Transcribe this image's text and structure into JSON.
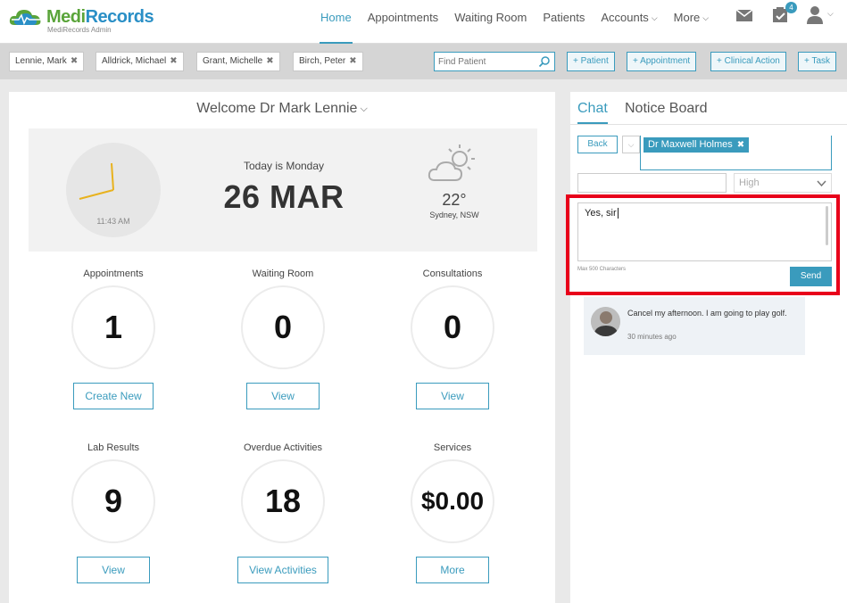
{
  "brand": {
    "name_part1": "Medi",
    "name_part2": "Records",
    "subtitle": "MediRecords Admin",
    "accent": "#3a9bbd"
  },
  "nav": {
    "items": [
      {
        "label": "Home",
        "active": true
      },
      {
        "label": "Appointments"
      },
      {
        "label": "Waiting Room"
      },
      {
        "label": "Patients"
      },
      {
        "label": "Accounts",
        "dropdown": true
      },
      {
        "label": "More",
        "dropdown": true
      }
    ],
    "tasks_badge": "4",
    "icons": [
      "mail-icon",
      "tasks-icon",
      "user-icon"
    ]
  },
  "patient_tabs": [
    {
      "label": "Lennie, Mark"
    },
    {
      "label": "Alldrick, Michael"
    },
    {
      "label": "Grant, Michelle"
    },
    {
      "label": "Birch, Peter"
    }
  ],
  "find_patient": {
    "placeholder": "Find Patient"
  },
  "quick_actions": [
    "+ Patient",
    "+ Appointment",
    "+ Clinical Action",
    "+ Task"
  ],
  "dashboard": {
    "welcome": "Welcome Dr Mark Lennie",
    "clock_time": "11:43 AM",
    "today_label": "Today is Monday",
    "date": "26 MAR",
    "weather": {
      "temp": "22°",
      "location": "Sydney, NSW"
    },
    "stats": [
      {
        "label": "Appointments",
        "value": "1",
        "button": "Create New"
      },
      {
        "label": "Waiting Room",
        "value": "0",
        "button": "View"
      },
      {
        "label": "Consultations",
        "value": "0",
        "button": "View"
      },
      {
        "label": "Lab Results",
        "value": "9",
        "button": "View"
      },
      {
        "label": "Overdue Activities",
        "value": "18",
        "button": "View Activities"
      },
      {
        "label": "Services",
        "value": "$0.00",
        "button": "More"
      }
    ]
  },
  "chat": {
    "tabs": [
      "Chat",
      "Notice Board"
    ],
    "back_label": "Back",
    "recipient": "Dr Maxwell Holmes",
    "subject_value": "",
    "priority": "High",
    "message_value": "Yes, sir",
    "max_chars_note": "Max 500 Characters",
    "send_label": "Send",
    "messages": [
      {
        "text": "Cancel my afternoon. I am going to play golf.",
        "time": "30 minutes ago"
      }
    ]
  }
}
